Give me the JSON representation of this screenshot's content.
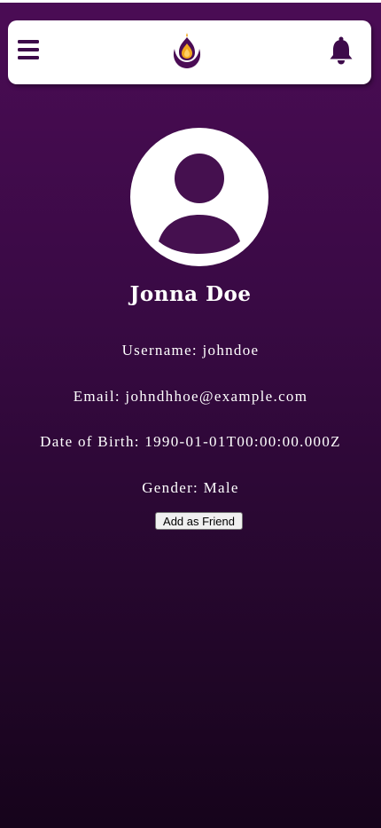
{
  "header": {
    "menu_icon": "hamburger-menu-icon",
    "logo_icon": "flame-lotus-logo",
    "notification_icon": "bell-icon"
  },
  "profile": {
    "avatar_icon": "user-avatar-icon",
    "name": "Jonna Doe",
    "username_line": "Username: johndoe",
    "email_line": "Email: johndhhoe@example.com",
    "dob_line": "Date of Birth: 1990-01-01T00:00:00.000Z",
    "gender_line": "Gender: Male"
  },
  "actions": {
    "add_friend_label": "Add as Friend"
  },
  "colors": {
    "brand_purple": "#4b0c55",
    "background_bottom": "#16041b",
    "logo_gold": "#f2a81d",
    "header_bg": "#ffffff"
  }
}
